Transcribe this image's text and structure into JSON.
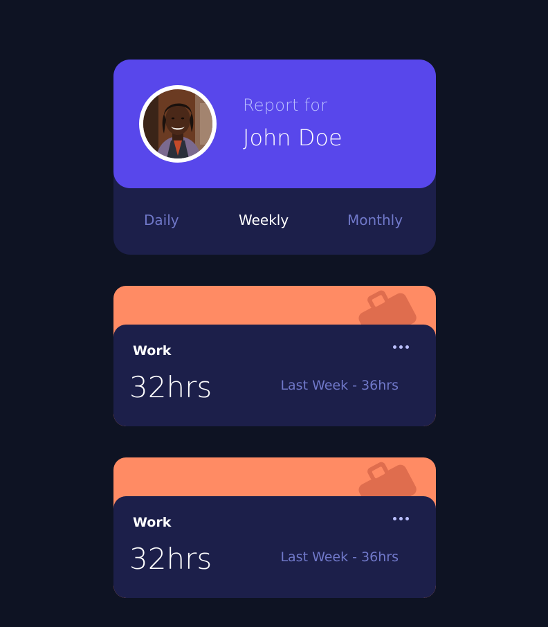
{
  "profile": {
    "report_label": "Report for",
    "name": "John Doe"
  },
  "tabs": [
    {
      "label": "Daily",
      "active": false
    },
    {
      "label": "Weekly",
      "active": true
    },
    {
      "label": "Monthly",
      "active": false
    }
  ],
  "activities": [
    {
      "title": "Work",
      "current": "32hrs",
      "previous": "Last Week - 36hrs",
      "icon": "briefcase-icon",
      "accent_color": "#ff8b64"
    },
    {
      "title": "Work",
      "current": "32hrs",
      "previous": "Last Week - 36hrs",
      "icon": "briefcase-icon",
      "accent_color": "#ff8b64"
    }
  ],
  "colors": {
    "background": "#0e1323",
    "card": "#1c1f4a",
    "profile_accent": "#5847eb",
    "pale_blue": "#bbc0ff",
    "desaturated_blue": "#7078c9"
  }
}
